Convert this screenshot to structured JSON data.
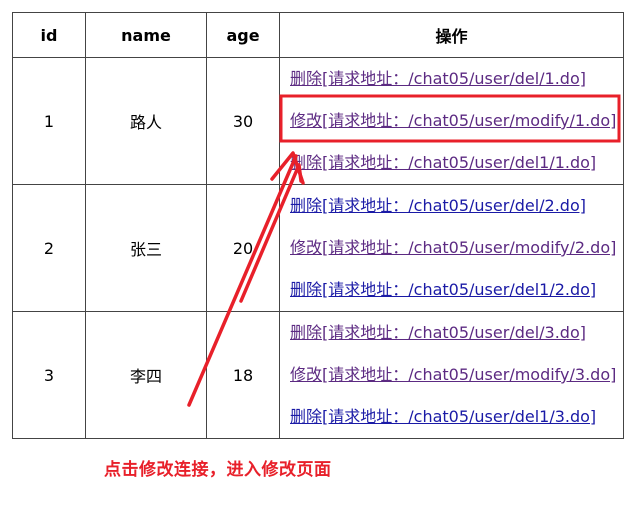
{
  "table": {
    "headers": [
      "id",
      "name",
      "age",
      "操作"
    ],
    "rows": [
      {
        "id": "1",
        "name": "路人",
        "age": "30",
        "actions": [
          {
            "label": "删除",
            "text": "[请求地址：/chat05/user/del/1.do]",
            "state": "visited"
          },
          {
            "label": "修改",
            "text": "[请求地址：/chat05/user/modify/1.do]",
            "state": "visited",
            "highlighted": true
          },
          {
            "label": "删除",
            "text": "[请求地址：/chat05/user/del1/1.do]",
            "state": "visited"
          }
        ]
      },
      {
        "id": "2",
        "name": "张三",
        "age": "20",
        "actions": [
          {
            "label": "删除",
            "text": "[请求地址：/chat05/user/del/2.do]",
            "state": "fresh"
          },
          {
            "label": "修改",
            "text": "[请求地址：/chat05/user/modify/2.do]",
            "state": "visited"
          },
          {
            "label": "删除",
            "text": "[请求地址：/chat05/user/del1/2.do]",
            "state": "fresh"
          }
        ]
      },
      {
        "id": "3",
        "name": "李四",
        "age": "18",
        "actions": [
          {
            "label": "删除",
            "text": "[请求地址：/chat05/user/del/3.do]",
            "state": "visited"
          },
          {
            "label": "修改",
            "text": "[请求地址：/chat05/user/modify/3.do]",
            "state": "visited"
          },
          {
            "label": "删除",
            "text": "[请求地址：/chat05/user/del1/3.do]",
            "state": "fresh"
          }
        ]
      }
    ]
  },
  "annotation": {
    "text": "点击修改连接，进入修改页面",
    "color": "#e8202a"
  },
  "colors": {
    "link_visited": "#5c2a82",
    "link_fresh": "#1a1aa6",
    "border": "#444444"
  }
}
